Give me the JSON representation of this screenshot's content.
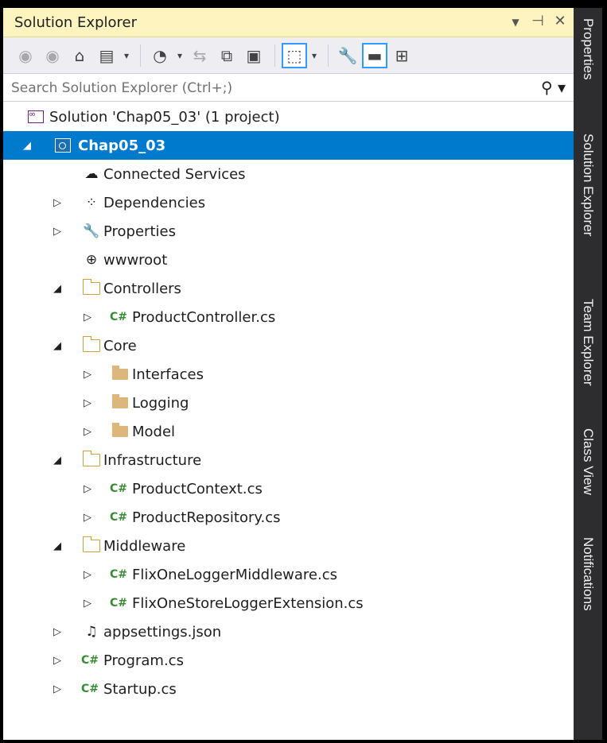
{
  "panel": {
    "title": "Solution Explorer",
    "title_icons": [
      "dropdown-arrow-icon",
      "pin-icon",
      "close-icon"
    ]
  },
  "toolbar": {
    "buttons": [
      "back-icon",
      "forward-icon",
      "home-icon",
      "switch-views-icon",
      "pending-changes-icon",
      "sync-icon",
      "collapse-all-icon",
      "show-all-files-icon",
      "preview-selected-icon",
      "properties-icon",
      "preview-icon",
      "new-solution-view-icon"
    ]
  },
  "search": {
    "placeholder": "Search Solution Explorer (Ctrl+;)"
  },
  "tree": {
    "solution": "Solution 'Chap05_03' (1 project)",
    "project": "Chap05_03",
    "connected_services": "Connected Services",
    "dependencies": "Dependencies",
    "properties": "Properties",
    "wwwroot": "wwwroot",
    "controllers": "Controllers",
    "product_controller": "ProductController.cs",
    "core": "Core",
    "interfaces": "Interfaces",
    "logging": "Logging",
    "model": "Model",
    "infrastructure": "Infrastructure",
    "product_context": "ProductContext.cs",
    "product_repository": "ProductRepository.cs",
    "middleware": "Middleware",
    "flixone_logger_middleware": "FlixOneLoggerMiddleware.cs",
    "flixone_store_logger_extension": "FlixOneStoreLoggerExtension.cs",
    "appsettings": "appsettings.json",
    "program": "Program.cs",
    "startup": "Startup.cs",
    "cs_badge": "C#"
  },
  "side_tabs": {
    "properties": "Properties",
    "solution_explorer": "Solution Explorer",
    "team_explorer": "Team Explorer",
    "class_view": "Class View",
    "notifications": "Notifications"
  },
  "colors": {
    "title_bar": "#fdf4bf",
    "selection": "#007acc",
    "side_rail": "#2d2d30",
    "csharp_badge": "#388a34"
  }
}
